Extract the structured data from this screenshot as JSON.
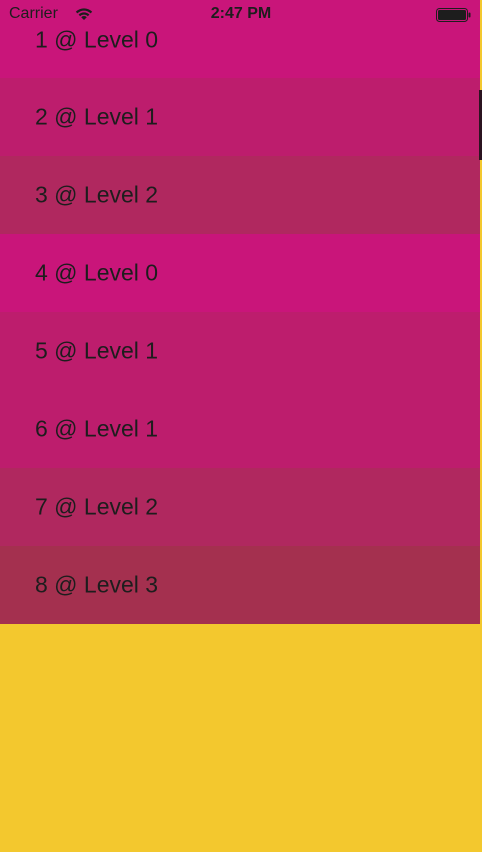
{
  "status_bar": {
    "carrier": "Carrier",
    "wifi_icon": "wifi-icon",
    "time": "2:47 PM",
    "battery_icon": "battery-icon"
  },
  "rows": [
    {
      "label": "1 @ Level 0",
      "color": "#c9157a"
    },
    {
      "label": "2 @ Level 1",
      "color": "#bd1d6d"
    },
    {
      "label": "3 @ Level 2",
      "color": "#b0285f"
    },
    {
      "label": "4 @ Level 0",
      "color": "#c9157a"
    },
    {
      "label": "5 @ Level 1",
      "color": "#bd1d6d"
    },
    {
      "label": "6 @ Level 1",
      "color": "#bd1d6d"
    },
    {
      "label": "7 @ Level 2",
      "color": "#b0285f"
    },
    {
      "label": "8 @ Level 3",
      "color": "#a4304f"
    }
  ],
  "colors": {
    "background": "#f3c82e"
  }
}
